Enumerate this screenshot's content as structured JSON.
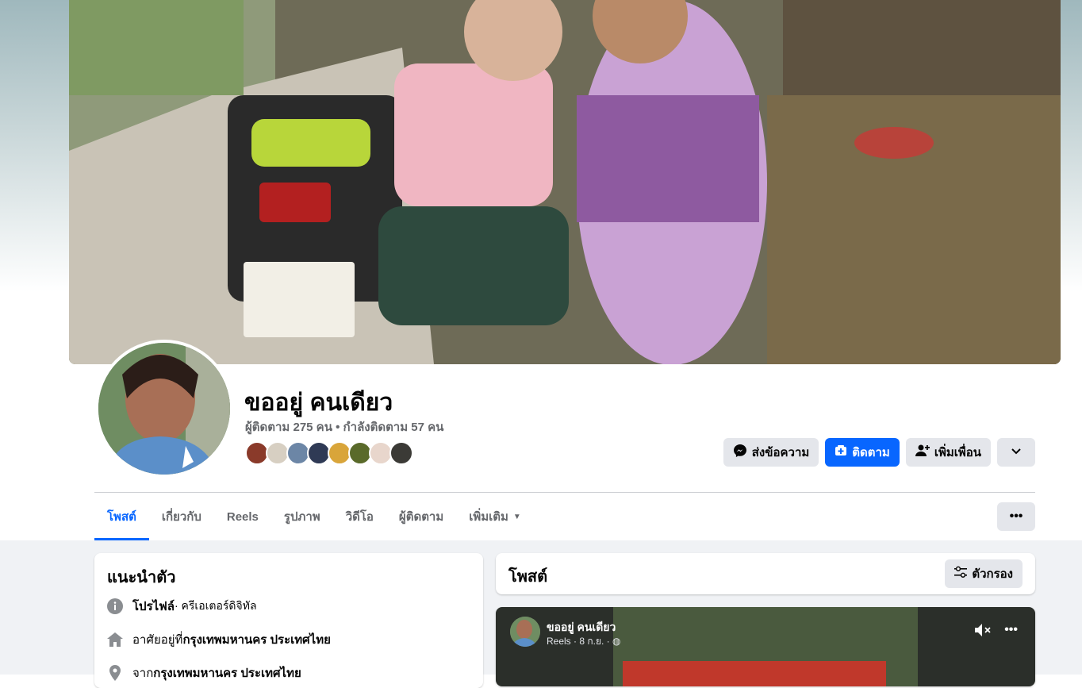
{
  "profile": {
    "name": "ขออยู่ คนเดียว",
    "followers_text": "ผู้ติดตาม 275 คน • กำลังติดตาม 57 คน"
  },
  "actions": {
    "message": "ส่งข้อความ",
    "follow": "ติดตาม",
    "add_friend": "เพิ่มเพื่อน"
  },
  "tabs": [
    {
      "label": "โพสต์",
      "active": true
    },
    {
      "label": "เกี่ยวกับ"
    },
    {
      "label": "Reels"
    },
    {
      "label": "รูปภาพ"
    },
    {
      "label": "วิดีโอ"
    },
    {
      "label": "ผู้ติดตาม"
    },
    {
      "label": "เพิ่มเติม"
    }
  ],
  "intro": {
    "title": "แนะนำตัว",
    "rows": [
      {
        "icon": "info-icon",
        "label": "โปรไฟล์",
        "value": " · ครีเอเตอร์ดิจิทัล"
      },
      {
        "icon": "home-icon",
        "label": "อาศัยอยู่ที่ ",
        "value": "กรุงเทพมหานคร ประเทศไทย"
      },
      {
        "icon": "location-icon",
        "label": "จาก ",
        "value": "กรุงเทพมหานคร ประเทศไทย"
      }
    ]
  },
  "posts": {
    "title": "โพสต์",
    "filter_label": "ตัวกรอง"
  },
  "reel": {
    "author": "ขออยู่ คนเดียว",
    "meta": "Reels · 8 ก.ย. ·"
  },
  "colors": {
    "accent": "#0866ff",
    "button_gray": "#e4e6eb",
    "feed_bg": "#f0f2f5"
  }
}
